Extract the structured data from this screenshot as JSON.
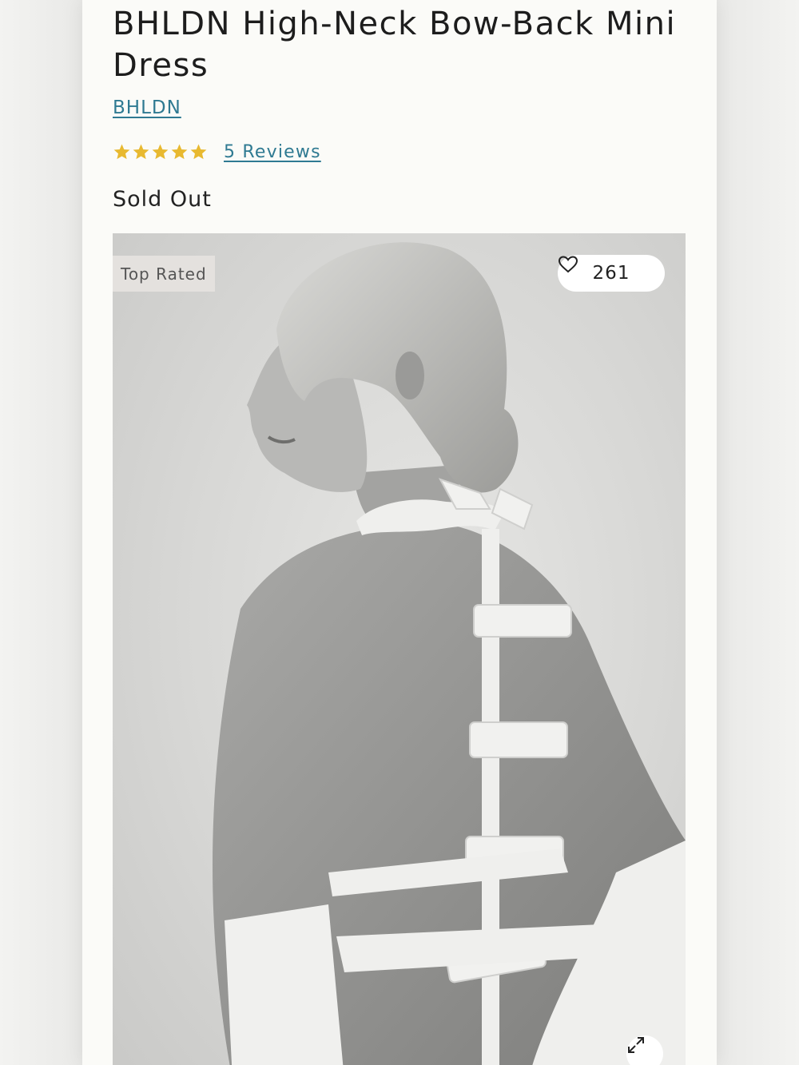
{
  "product": {
    "title": "BHLDN High-Neck Bow-Back Mini Dress",
    "brand": "BHLDN",
    "rating": 5,
    "rating_max": 5,
    "reviews_label": "5 Reviews",
    "stock_status": "Sold Out"
  },
  "image": {
    "badge": "Top Rated",
    "favorite_count": "261",
    "favorite_icon": "heart-icon",
    "zoom_icon": "expand-arrows-icon"
  },
  "colors": {
    "link": "#2f7a92",
    "star": "#e8b930",
    "background": "#fbfbf8"
  }
}
